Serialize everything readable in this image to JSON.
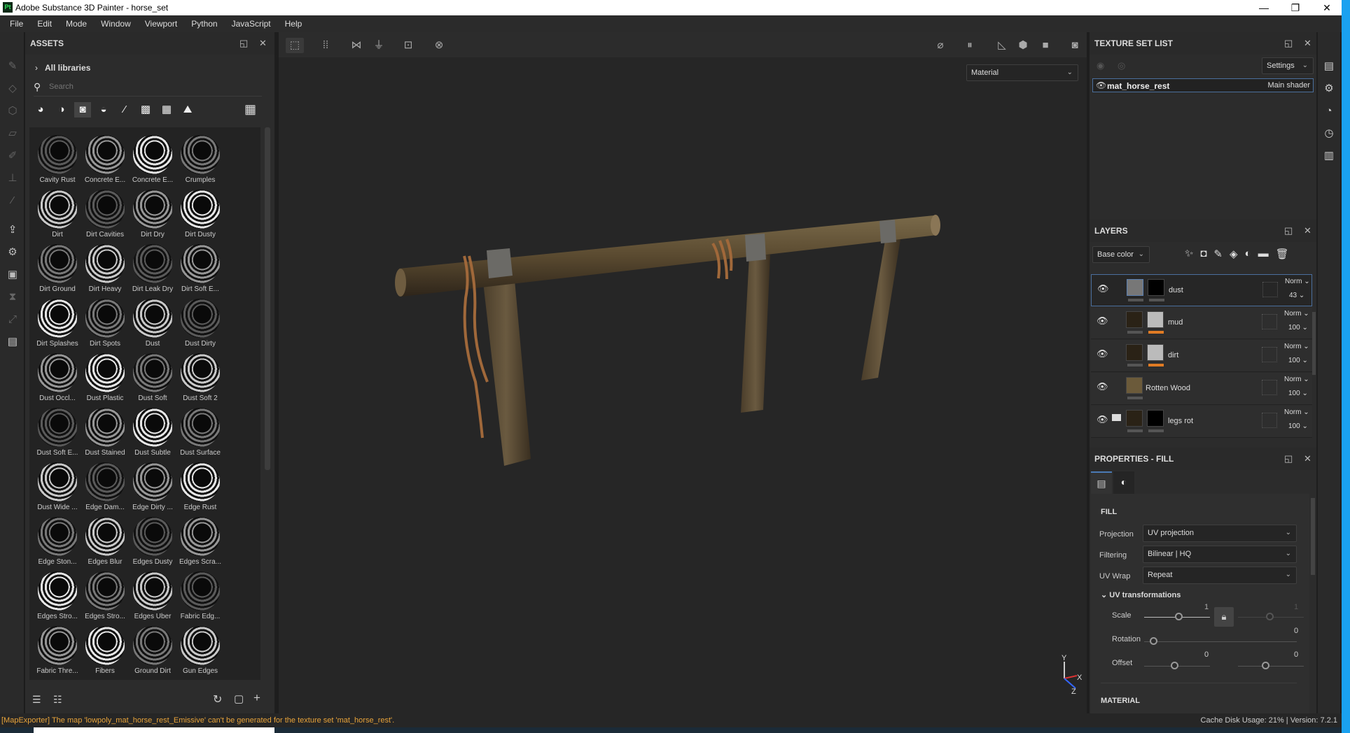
{
  "window": {
    "app_icon": "Pt",
    "title": "Adobe Substance 3D Painter - horse_set",
    "minimize": "—",
    "maximize": "❐",
    "close": "✕"
  },
  "menu": [
    "File",
    "Edit",
    "Mode",
    "Window",
    "Viewport",
    "Python",
    "JavaScript",
    "Help"
  ],
  "assets": {
    "title": "ASSETS",
    "library": "All libraries",
    "search_placeholder": "Search",
    "filter_icons": [
      "material-sphere-icon",
      "smart-material-icon",
      "smart-mask-icon",
      "filter-icon",
      "brush-icon",
      "alpha-icon",
      "texture-icon",
      "environment-icon"
    ],
    "items": [
      "Cavity Rust",
      "Concrete E...",
      "Concrete E...",
      "Crumples",
      "Dirt",
      "Dirt Cavities",
      "Dirt Dry",
      "Dirt Dusty",
      "Dirt Ground",
      "Dirt Heavy",
      "Dirt Leak Dry",
      "Dirt Soft E...",
      "Dirt Splashes",
      "Dirt Spots",
      "Dust",
      "Dust Dirty",
      "Dust Occl...",
      "Dust Plastic",
      "Dust Soft",
      "Dust Soft 2",
      "Dust Soft E...",
      "Dust Stained",
      "Dust Subtle",
      "Dust Surface",
      "Dust Wide ...",
      "Edge Dam...",
      "Edge Dirty ...",
      "Edge Rust",
      "Edge Ston...",
      "Edges Blur",
      "Edges Dusty",
      "Edges Scra...",
      "Edges Stro...",
      "Edges Stro...",
      "Edges Uber",
      "Fabric Edg...",
      "Fabric Thre...",
      "Fibers",
      "Ground Dirt",
      "Gun Edges",
      "",
      "",
      "",
      ""
    ]
  },
  "viewport": {
    "mode": "Material",
    "axis": {
      "y": "Y",
      "x": "X",
      "z": "Z"
    }
  },
  "texture_set_list": {
    "title": "TEXTURE SET LIST",
    "settings": "Settings",
    "sets": [
      {
        "name": "mat_horse_rest",
        "shader": "Main shader"
      }
    ]
  },
  "layers": {
    "title": "LAYERS",
    "channel": "Base color",
    "rows": [
      {
        "name": "dust",
        "blend": "Norm",
        "opacity": "43",
        "selected": true,
        "mask_tag": false,
        "folder": false
      },
      {
        "name": "mud",
        "blend": "Norm",
        "opacity": "100",
        "selected": false,
        "mask_tag": true,
        "folder": false
      },
      {
        "name": "dirt",
        "blend": "Norm",
        "opacity": "100",
        "selected": false,
        "mask_tag": true,
        "folder": false
      },
      {
        "name": "Rotten Wood",
        "blend": "Norm",
        "opacity": "100",
        "selected": false,
        "mask_tag": false,
        "folder": false,
        "no_mask": true
      },
      {
        "name": "legs rot",
        "blend": "Norm",
        "opacity": "100",
        "selected": false,
        "mask_tag": false,
        "folder": true
      }
    ]
  },
  "properties": {
    "title": "PROPERTIES - FILL",
    "section": "FILL",
    "projection_label": "Projection",
    "projection": "UV projection",
    "filtering_label": "Filtering",
    "filtering": "Bilinear | HQ",
    "uvwrap_label": "UV Wrap",
    "uvwrap": "Repeat",
    "uv_transform": "UV transformations",
    "scale_label": "Scale",
    "scale_u": "1",
    "scale_v": "1",
    "rotation_label": "Rotation",
    "rotation": "0",
    "offset_label": "Offset",
    "offset_u": "0",
    "offset_v": "0",
    "material": "MATERIAL"
  },
  "status": {
    "message": "[MapExporter] The map 'lowpoly_mat_horse_rest_Emissive' can't be generated for the texture set 'mat_horse_rest'.",
    "cache": "Cache Disk Usage:   21% | Version: 7.2.1"
  },
  "colors": {
    "accent": "#1aa1f0",
    "warning": "#e8a33a",
    "mask_tag": "#e07b24",
    "selection": "#4b6f9d"
  }
}
